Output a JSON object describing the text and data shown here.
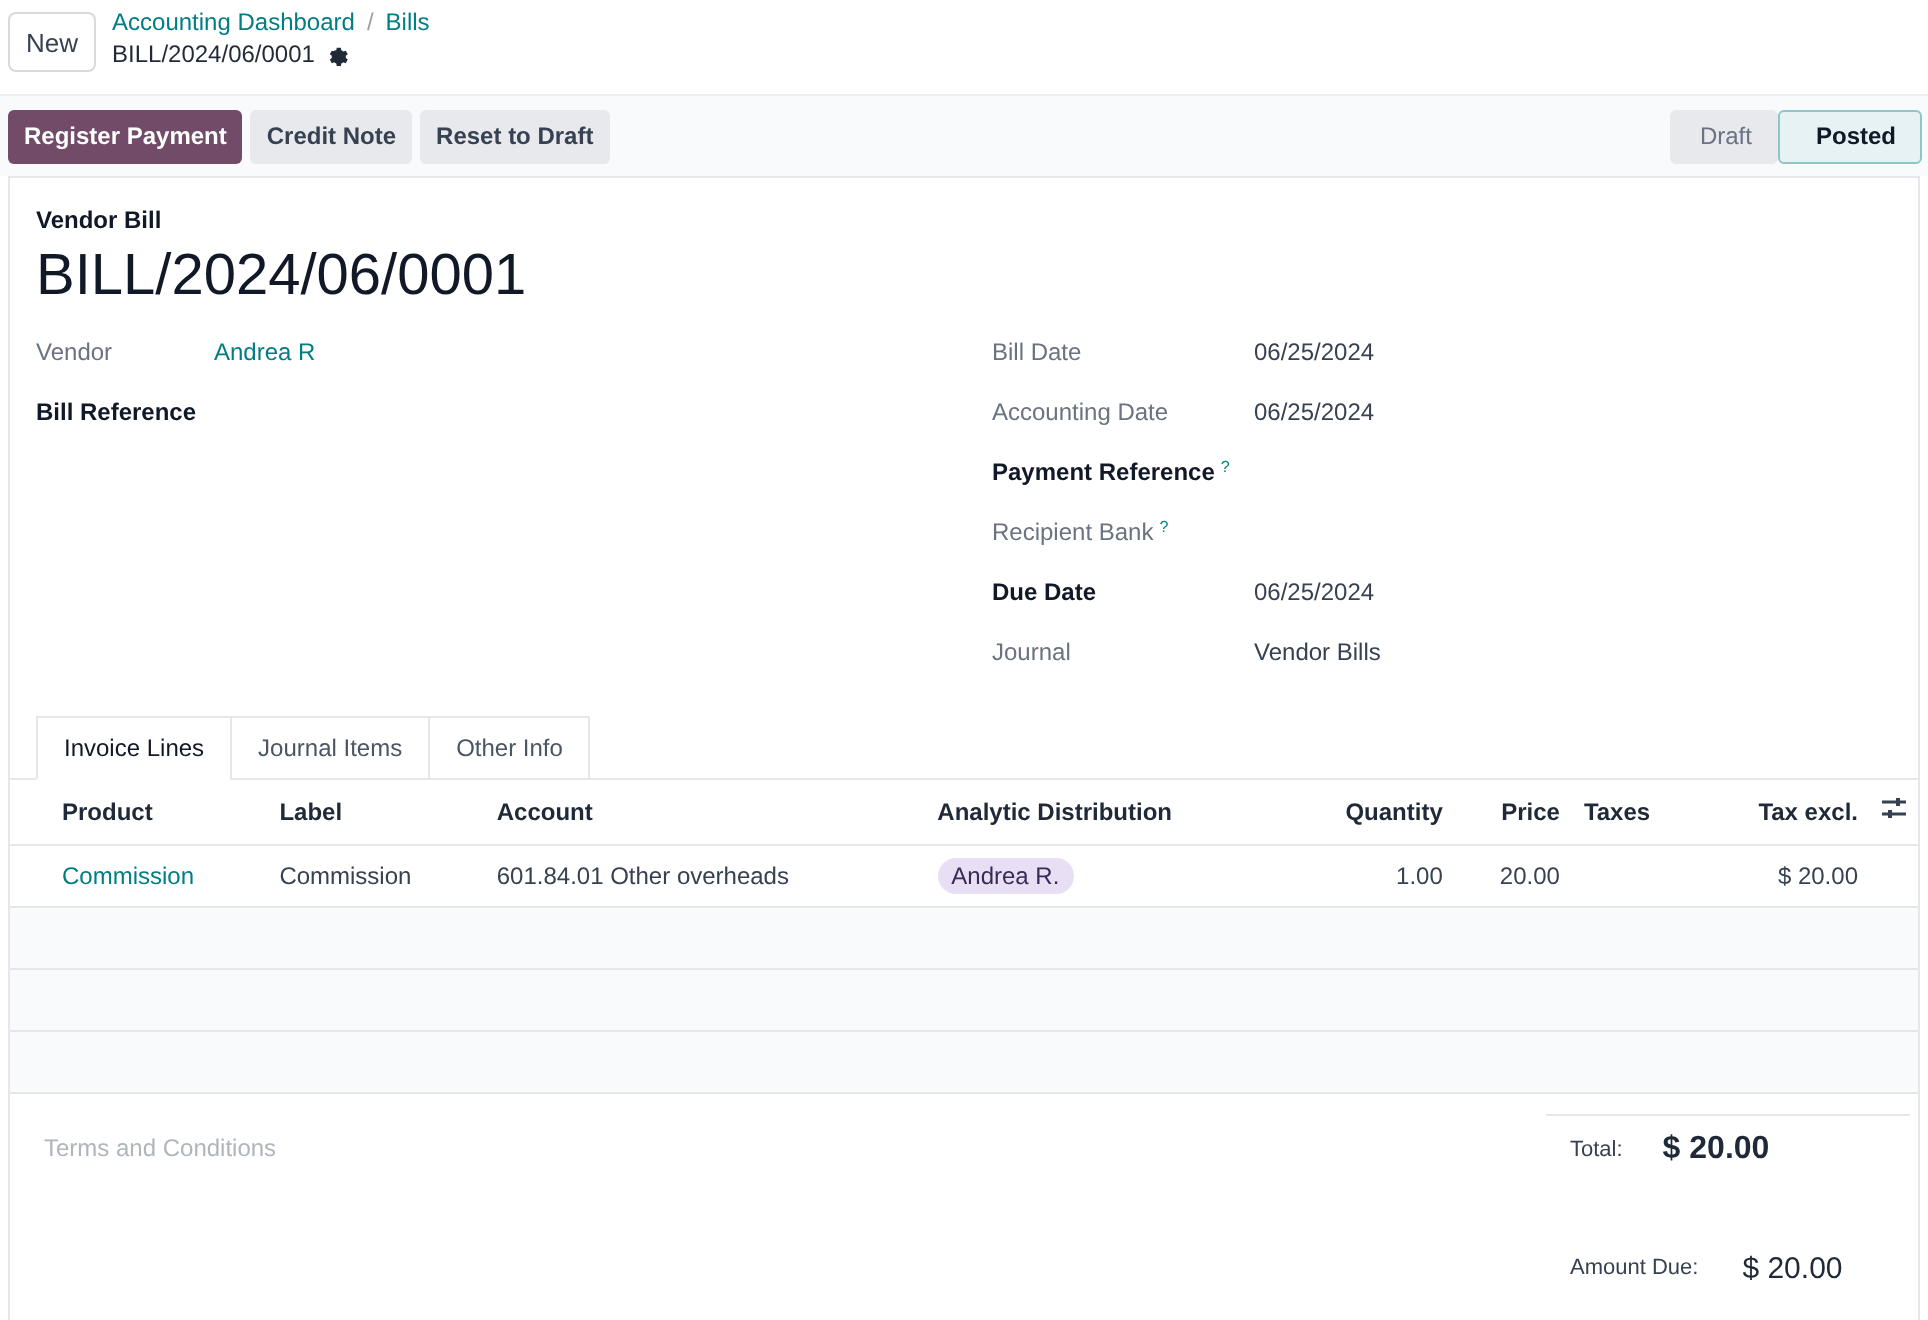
{
  "new_button": "New",
  "breadcrumbs": [
    "Accounting Dashboard",
    "Bills"
  ],
  "breadcrumb_separator": "/",
  "record_title": "BILL/2024/06/0001",
  "actions": [
    {
      "label": "Register Payment",
      "kind": "primary"
    },
    {
      "label": "Credit Note",
      "kind": "secondary"
    },
    {
      "label": "Reset to Draft",
      "kind": "secondary"
    }
  ],
  "statusbar": [
    {
      "label": "Draft",
      "selected": false
    },
    {
      "label": "Posted",
      "selected": true
    }
  ],
  "form": {
    "type_label": "Vendor Bill",
    "name": "BILL/2024/06/0001",
    "left_fields": [
      {
        "label": "Vendor",
        "bold": false,
        "value": "Andrea R",
        "link": true
      },
      {
        "label": "Bill Reference",
        "bold": true
      }
    ],
    "right_fields": [
      {
        "label": "Bill Date",
        "bold": false,
        "value": "06/25/2024"
      },
      {
        "label": "Accounting Date",
        "bold": false,
        "value": "06/25/2024"
      },
      {
        "label": "Payment Reference",
        "bold": true,
        "help": "?"
      },
      {
        "label": "Recipient Bank",
        "bold": false,
        "help": "?"
      },
      {
        "label": "Due Date",
        "bold": true,
        "value": "06/25/2024"
      },
      {
        "label": "Journal",
        "bold": false,
        "value": "Vendor Bills"
      }
    ]
  },
  "tabs": [
    {
      "label": "Invoice Lines",
      "selected": true
    },
    {
      "label": "Journal Items",
      "selected": false
    },
    {
      "label": "Other Info",
      "selected": false
    }
  ],
  "table": {
    "columns": [
      "Product",
      "Label",
      "Account",
      "Analytic Distribution",
      "Quantity",
      "Price",
      "Taxes",
      "Tax excl."
    ],
    "rows": [
      {
        "product": "Commission",
        "label": "Commission",
        "account": "601.84.01 Other overheads",
        "analytic": "Andrea R.",
        "quantity": "1.00",
        "price": "20.00",
        "subtotal": "$ 20.00"
      }
    ]
  },
  "terms_placeholder": "Terms and Conditions",
  "totals": [
    {
      "label": "Total:",
      "value": "$ 20.00",
      "kind": "total"
    },
    {
      "label": "Amount Due:",
      "value": "$ 20.00",
      "kind": "due"
    }
  ]
}
